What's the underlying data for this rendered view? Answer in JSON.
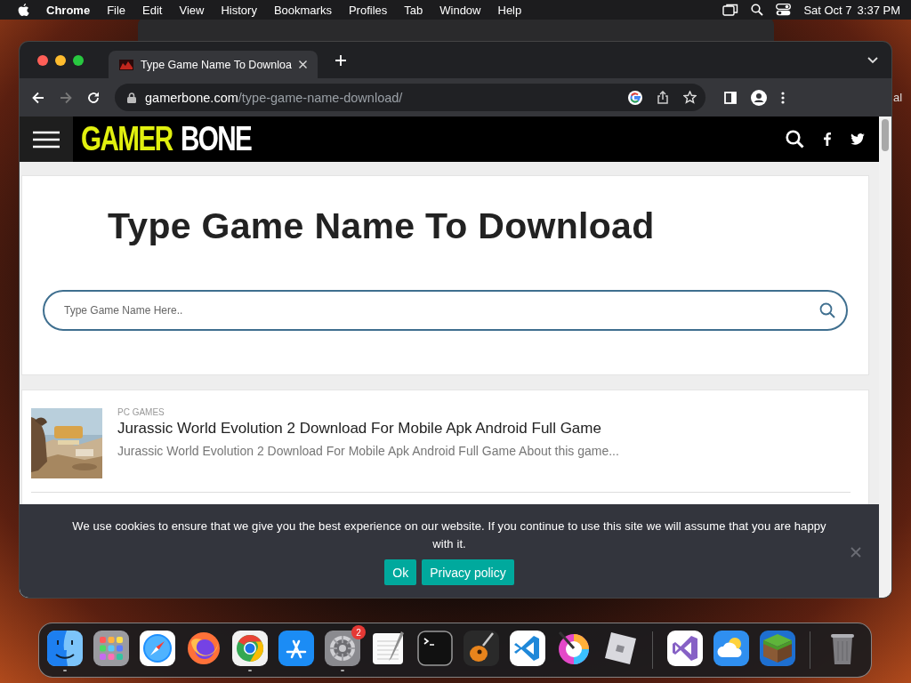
{
  "menu_bar": {
    "app": "Chrome",
    "menus": [
      "File",
      "Edit",
      "View",
      "History",
      "Bookmarks",
      "Profiles",
      "Tab",
      "Window",
      "Help"
    ],
    "date": "Sat Oct 7",
    "time": "3:37 PM"
  },
  "background_window": {
    "text": "al"
  },
  "browser": {
    "tabs": [
      {
        "title": "Type Game Name To Downloa",
        "selected": true
      }
    ],
    "address": {
      "host": "gamerbone.com",
      "path": "/type-game-name-download/"
    }
  },
  "site": {
    "logo": {
      "first": "GAMER",
      "second": "BONE"
    },
    "heading": "Type Game Name To Download",
    "search": {
      "placeholder": "Type Game Name Here.."
    },
    "posts": [
      {
        "category": "PC GAMES",
        "title": "Jurassic World Evolution 2 Download For Mobile Apk Android Full Game",
        "excerpt": "Jurassic World Evolution 2 Download For Mobile Apk Android Full Game About this game..."
      }
    ]
  },
  "cookie_notice": {
    "text": "We use cookies to ensure that we give you the best experience on our website. If you continue to use this site we will assume that you are happy with it.",
    "buttons": [
      "Ok",
      "Privacy policy"
    ]
  },
  "dock": {
    "items": [
      {
        "kind": "finder",
        "running": true
      },
      {
        "kind": "launchpad",
        "running": false
      },
      {
        "kind": "safari",
        "running": false
      },
      {
        "kind": "firefox",
        "running": false
      },
      {
        "kind": "chrome",
        "running": true
      },
      {
        "kind": "appstore",
        "running": false
      },
      {
        "kind": "settings",
        "running": true,
        "badge": "2"
      },
      {
        "kind": "textedit",
        "running": false
      },
      {
        "kind": "terminal",
        "running": false
      },
      {
        "kind": "garageband",
        "running": false
      },
      {
        "kind": "vscode",
        "running": false
      },
      {
        "kind": "paint",
        "running": false
      },
      {
        "kind": "roblox",
        "running": false
      },
      {
        "kind": "separator"
      },
      {
        "kind": "visualstudio",
        "running": false
      },
      {
        "kind": "weather",
        "running": false
      },
      {
        "kind": "minecraft",
        "running": false
      },
      {
        "kind": "separator"
      },
      {
        "kind": "trash",
        "running": false
      }
    ]
  }
}
